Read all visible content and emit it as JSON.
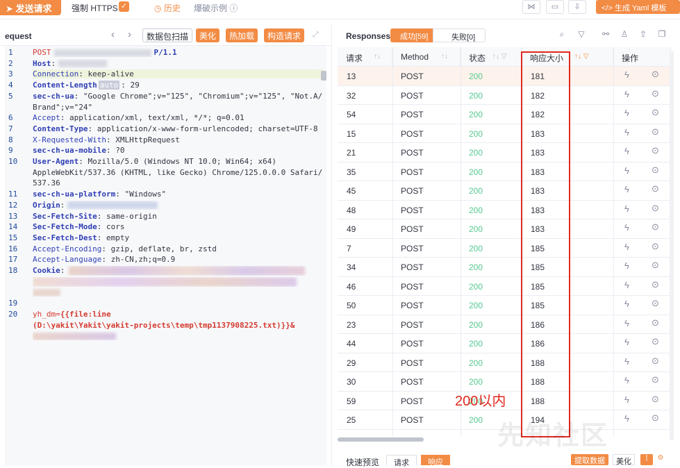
{
  "toolbar": {
    "send_label": "发送请求",
    "force_https_label": "强制 HTTPS",
    "history_label": "历史",
    "examples_label": "爆破示例",
    "yaml_label": "</> 生成 Yaml 模板"
  },
  "request_panel": {
    "title": "equest",
    "btn_scan": "数据包扫描",
    "btn_beautify": "美化",
    "btn_hot": "热加载",
    "btn_construct": "构造请求",
    "lines": [
      {
        "n": "1",
        "key": "POST",
        "rest": "P/1.1"
      },
      {
        "n": "2",
        "key": "Host",
        "rest": ":"
      },
      {
        "n": "3",
        "key": "Connection",
        "rest": ": keep-alive"
      },
      {
        "n": "4",
        "key": "Content-Length",
        "badge": "auto",
        "rest": ": 29"
      },
      {
        "n": "5",
        "key": "sec-ch-ua",
        "rest": ": \"Google Chrome\";v=\"125\", \"Chromium\";v=\"125\", \"Not.A/"
      },
      {
        "n": "",
        "key": "",
        "rest": "Brand\";v=\"24\""
      },
      {
        "n": "6",
        "key": "Accept",
        "rest": ": application/xml, text/xml, */*; q=0.01"
      },
      {
        "n": "7",
        "key": "Content-Type",
        "rest": ": application/x-www-form-urlencoded; charset=UTF-8"
      },
      {
        "n": "8",
        "key": "X-Requested-With",
        "rest": ": XMLHttpRequest"
      },
      {
        "n": "9",
        "key": "sec-ch-ua-mobile",
        "rest": ": ?0"
      },
      {
        "n": "10",
        "key": "User-Agent",
        "rest": ": Mozilla/5.0 (Windows NT 10.0; Win64; x64)"
      },
      {
        "n": "",
        "key": "",
        "rest": "AppleWebKit/537.36 (KHTML, like Gecko) Chrome/125.0.0.0 Safari/"
      },
      {
        "n": "",
        "key": "",
        "rest": "537.36"
      },
      {
        "n": "11",
        "key": "sec-ch-ua-platform",
        "rest": ": \"Windows\""
      },
      {
        "n": "12",
        "key": "Origin",
        "rest": ":"
      },
      {
        "n": "13",
        "key": "Sec-Fetch-Site",
        "rest": ": same-origin"
      },
      {
        "n": "14",
        "key": "Sec-Fetch-Mode",
        "rest": ": cors"
      },
      {
        "n": "15",
        "key": "Sec-Fetch-Dest",
        "rest": ": empty"
      },
      {
        "n": "16",
        "key": "Accept-Encoding",
        "rest": ": gzip, deflate, br, zstd"
      },
      {
        "n": "17",
        "key": "Accept-Language",
        "rest": ": zh-CN,zh;q=0.9"
      },
      {
        "n": "18",
        "key": "Cookie",
        "rest": ":"
      },
      {
        "n": "",
        "key": "c",
        "rest": ""
      },
      {
        "n": "",
        "key": "",
        "rest": ""
      },
      {
        "n": "19",
        "key": "",
        "rest": ""
      },
      {
        "n": "20",
        "key": "yh_dm=",
        "rest": "{{file:line"
      },
      {
        "n": "",
        "key": "",
        "rest": "(D:\\yakit\\Yakit\\yakit-projects\\temp\\tmp1137908225.txt)}}&"
      },
      {
        "n": "",
        "key": "",
        "rest": ""
      }
    ]
  },
  "responses_panel": {
    "title": "Responses",
    "tab_success": "成功[59]",
    "tab_fail": "失败[0]",
    "columns": [
      "请求",
      "Method",
      "状态",
      "响应大小",
      "操作"
    ],
    "rows": [
      [
        "13",
        "POST",
        "200",
        "181"
      ],
      [
        "32",
        "POST",
        "200",
        "182"
      ],
      [
        "54",
        "POST",
        "200",
        "182"
      ],
      [
        "15",
        "POST",
        "200",
        "183"
      ],
      [
        "21",
        "POST",
        "200",
        "183"
      ],
      [
        "35",
        "POST",
        "200",
        "183"
      ],
      [
        "45",
        "POST",
        "200",
        "183"
      ],
      [
        "48",
        "POST",
        "200",
        "183"
      ],
      [
        "49",
        "POST",
        "200",
        "183"
      ],
      [
        "7",
        "POST",
        "200",
        "185"
      ],
      [
        "34",
        "POST",
        "200",
        "185"
      ],
      [
        "46",
        "POST",
        "200",
        "185"
      ],
      [
        "50",
        "POST",
        "200",
        "185"
      ],
      [
        "23",
        "POST",
        "200",
        "186"
      ],
      [
        "44",
        "POST",
        "200",
        "186"
      ],
      [
        "29",
        "POST",
        "200",
        "188"
      ],
      [
        "30",
        "POST",
        "200",
        "188"
      ],
      [
        "59",
        "POST",
        "200",
        "188"
      ],
      [
        "25",
        "POST",
        "200",
        "194"
      ]
    ],
    "annotation": "200以内"
  },
  "bottom": {
    "quick_preview": "快速预览",
    "tab_request": "请求",
    "tab_response": "响应",
    "extract": "提取数据",
    "beautify": "美化"
  },
  "watermark": "先知社区",
  "colors": {
    "accent": "#f28b44",
    "status_ok": "#56c991",
    "annotation": "#e0281e"
  }
}
